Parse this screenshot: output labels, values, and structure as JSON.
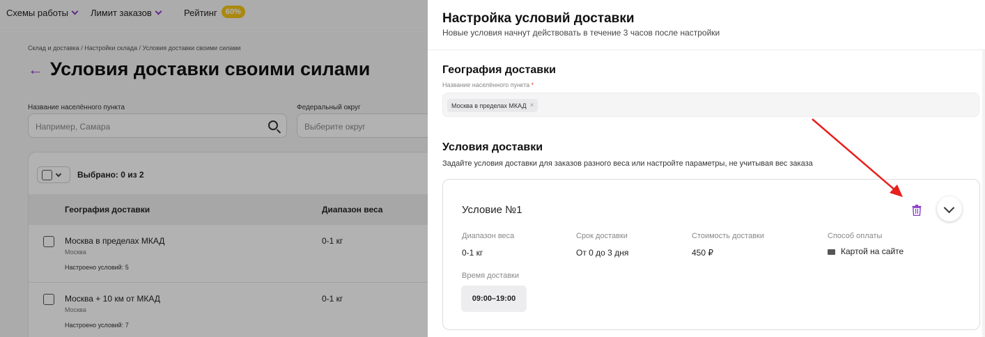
{
  "topbar": {
    "menu_work_schemes": "Схемы работы",
    "menu_order_limit": "Лимит заказов",
    "menu_rating": "Рейтинг",
    "rating_badge": "60%"
  },
  "breadcrumb": "Склад и доставка  /  Настройки склада  /  Условия доставки своими силами",
  "page_title": "Условия доставки своими силами",
  "filters": {
    "city_label": "Название населённого пункта",
    "city_placeholder": "Например, Самара",
    "district_label": "Федеральный округ",
    "district_placeholder": "Выберите округ"
  },
  "table": {
    "selected_text": "Выбрано: 0 из 2",
    "col_geo": "География доставки",
    "col_weight": "Диапазон веса",
    "rows": [
      {
        "title": "Москва в пределах МКАД",
        "sub": "Москва",
        "count": "Настроено условий: 5",
        "weight": "0-1 кг"
      },
      {
        "title": "Москва + 10 км от МКАД",
        "sub": "Москва",
        "count": "Настроено условий: 7",
        "weight": "0-1 кг"
      }
    ]
  },
  "drawer": {
    "title": "Настройка условий доставки",
    "subtitle": "Новые условия начнут действовать в течение 3 часов после настройки",
    "geo_section_title": "География доставки",
    "geo_field_label": "Название населённого пункта",
    "geo_required_mark": "*",
    "geo_chip": "Москва в пределах МКАД",
    "chip_remove": "×",
    "cond_section_title": "Условия доставки",
    "cond_section_desc": "Задайте условия доставки для заказов разного веса или настройте параметры, не учитывая вес заказа",
    "condition": {
      "title": "Условие №1",
      "weight_label": "Диапазон веса",
      "weight_value": "0-1 кг",
      "term_label": "Срок доставки",
      "term_value": "От 0 до 3 дня",
      "cost_label": "Стоимость доставки",
      "cost_value": "450 ₽",
      "payment_label": "Способ оплаты",
      "payment_value": "Картой на сайте",
      "time_label": "Время доставки",
      "time_value": "09:00–19:00"
    }
  },
  "colors": {
    "accent": "#8b3ec7",
    "annotation_arrow": "#e8201c",
    "badge": "#f5c518"
  }
}
